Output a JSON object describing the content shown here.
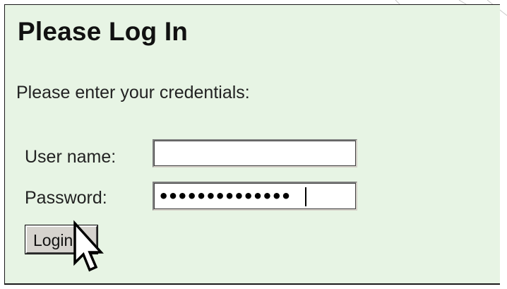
{
  "login": {
    "title": "Please Log In",
    "instructions": "Please enter your credentials:",
    "username_label": "User name:",
    "username_value": "",
    "password_label": "Password:",
    "password_value": "••••••••••••••",
    "login_button": "Login"
  },
  "colors": {
    "panel_background": "#e7f4e4",
    "panel_border": "#1a1a1a",
    "button_face": "#d6d3ce"
  },
  "icons": {
    "cursor": "arrow-pointer-icon"
  }
}
